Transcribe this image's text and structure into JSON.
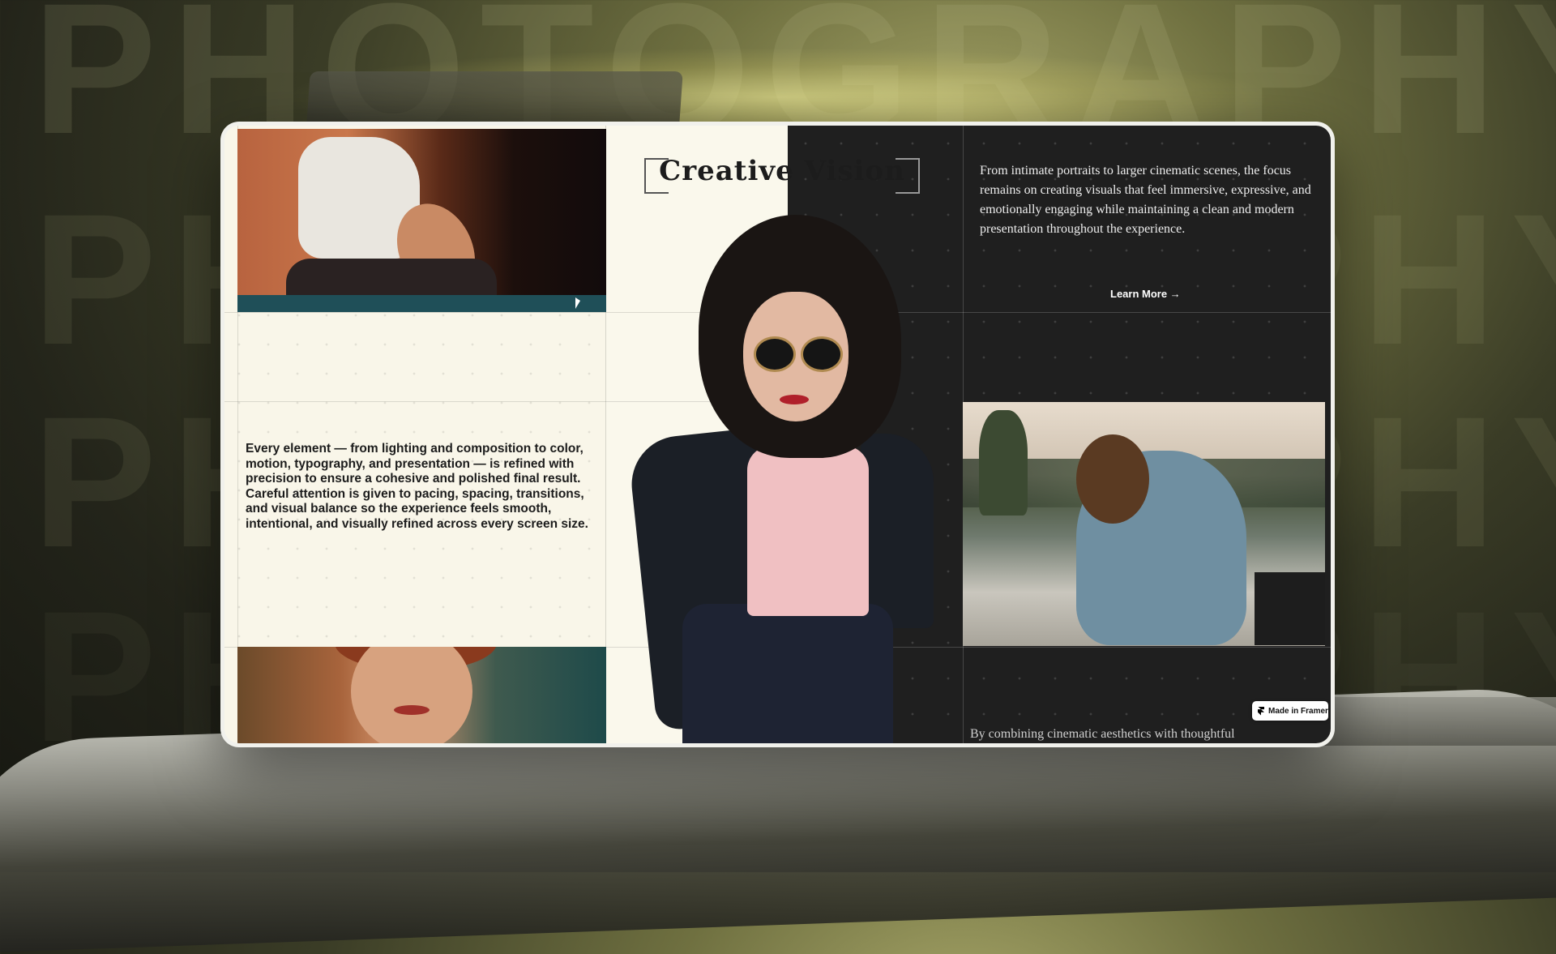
{
  "page": {
    "title": "Creative Vision",
    "description": "From intimate portraits to larger cinematic scenes, the focus remains on creating visuals that feel immersive, expressive, and emotionally engaging while maintaining a clean and modern presentation throughout the experience.",
    "learn_more_label": "Learn More →",
    "body_text": "Every element — from lighting and composition to color, motion, typography, and presentation — is refined with precision to ensure a cohesive and polished final result. Careful attention is given to pacing, spacing, transitions, and visual balance so the experience feels smooth, intentional, and visually refined across every screen size.",
    "bottom_text_partial": "By combining cinematic aesthetics with thoughtful",
    "badge_label": "Made in Framer"
  },
  "colors": {
    "light_panel": "#f9f6e9",
    "dark_panel": "#1f1f1f",
    "title_text": "#1c1c1c",
    "description_text": "#ededed"
  },
  "icons": [
    "framer-logo-icon",
    "arrow-right-icon",
    "cursor-icon"
  ]
}
